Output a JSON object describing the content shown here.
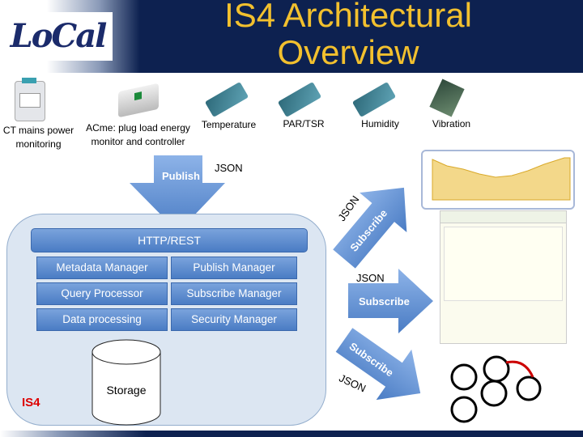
{
  "header": {
    "title_line1": "IS4 Architectural",
    "title_line2": "Overview",
    "logo_text": "LoCal"
  },
  "sensors": [
    {
      "label_line1": "CT mains power",
      "label_line2": "monitoring"
    },
    {
      "label_line1": "ACme: plug load energy",
      "label_line2": "monitor and controller"
    },
    {
      "label_line1": "Temperature"
    },
    {
      "label_line1": "PAR/TSR"
    },
    {
      "label_line1": "Humidity"
    },
    {
      "label_line1": "Vibration"
    }
  ],
  "publish": {
    "label": "Publish",
    "format": "JSON"
  },
  "is4": {
    "label": "IS4",
    "interface": "HTTP/REST",
    "components": [
      "Metadata Manager",
      "Publish Manager",
      "Query Processor",
      "Subscribe Manager",
      "Data processing",
      "Security Manager"
    ],
    "storage": "Storage"
  },
  "subscribe": [
    {
      "label": "Subscribe",
      "format": "JSON"
    },
    {
      "label": "Subscribe",
      "format": "JSON"
    },
    {
      "label": "Subscribe",
      "format": "JSON"
    }
  ],
  "colors": {
    "header": "#0d2150",
    "title": "#f2c02e",
    "arrow": "#5b8fd6",
    "is4_label": "#dd0000"
  }
}
